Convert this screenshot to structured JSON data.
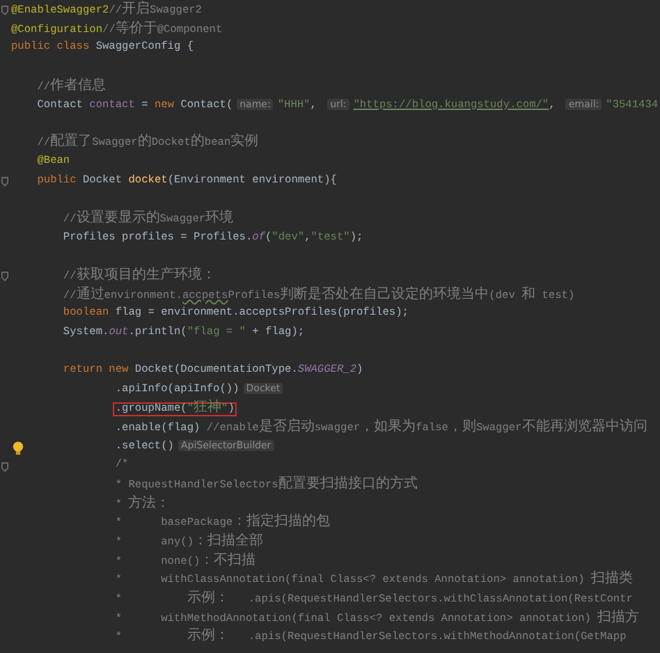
{
  "editor": {
    "lines": [
      {
        "kind": "code",
        "gutter": {
          "kind": "fold"
        },
        "tokens": [
          {
            "kind": "annotation",
            "text": "@EnableSwagger2"
          },
          {
            "kind": "comment",
            "text": "//开启Swagger2"
          }
        ]
      },
      {
        "kind": "code",
        "tokens": [
          {
            "kind": "annotation",
            "text": "@Configuration"
          },
          {
            "kind": "comment",
            "text": "//等价于@Component"
          }
        ]
      },
      {
        "kind": "code",
        "tokens": [
          {
            "kind": "keyword",
            "text": "public class "
          },
          {
            "kind": "plain",
            "text": "SwaggerConfig {"
          }
        ]
      },
      {
        "kind": "blank"
      },
      {
        "kind": "code",
        "tokens": [
          {
            "kind": "comment",
            "text": "    //作者信息"
          }
        ]
      },
      {
        "kind": "code",
        "tokens": [
          {
            "kind": "plain",
            "text": "    Contact "
          },
          {
            "kind": "field",
            "text": "contact"
          },
          {
            "kind": "plain",
            "text": " = "
          },
          {
            "kind": "keyword",
            "text": "new "
          },
          {
            "kind": "plain",
            "text": "Contact("
          },
          {
            "kind": "hint",
            "text": "name:"
          },
          {
            "kind": "string",
            "text": "\"HHH\""
          },
          {
            "kind": "plain",
            "text": ", "
          },
          {
            "kind": "hint",
            "text": "url:"
          },
          {
            "kind": "url",
            "text": "\"https://blog.kuangstudy.com/\""
          },
          {
            "kind": "plain",
            "text": ", "
          },
          {
            "kind": "hint",
            "text": "email:"
          },
          {
            "kind": "string",
            "text": "\"3541434"
          }
        ]
      },
      {
        "kind": "blank"
      },
      {
        "kind": "code",
        "tokens": [
          {
            "kind": "comment",
            "text": "    //配置了Swagger的Docket的bean实例"
          }
        ]
      },
      {
        "kind": "code",
        "tokens": [
          {
            "kind": "annotation",
            "text": "    @Bean"
          }
        ]
      },
      {
        "kind": "code",
        "gutter": {
          "kind": "fold"
        },
        "tokens": [
          {
            "kind": "keyword",
            "text": "    public "
          },
          {
            "kind": "plain",
            "text": "Docket "
          },
          {
            "kind": "method",
            "text": "docket"
          },
          {
            "kind": "plain",
            "text": "(Environment environment){"
          }
        ]
      },
      {
        "kind": "blank"
      },
      {
        "kind": "code",
        "tokens": [
          {
            "kind": "comment",
            "text": "        //设置要显示的Swagger环境"
          }
        ]
      },
      {
        "kind": "code",
        "tokens": [
          {
            "kind": "plain",
            "text": "        Profiles profiles = Profiles."
          },
          {
            "kind": "static",
            "text": "of"
          },
          {
            "kind": "plain",
            "text": "("
          },
          {
            "kind": "string",
            "text": "\"dev\""
          },
          {
            "kind": "plain",
            "text": ","
          },
          {
            "kind": "string",
            "text": "\"test\""
          },
          {
            "kind": "plain",
            "text": ");"
          }
        ]
      },
      {
        "kind": "blank"
      },
      {
        "kind": "code",
        "gutter": {
          "kind": "fold"
        },
        "tokens": [
          {
            "kind": "comment",
            "text": "        //获取项目的生产环境："
          }
        ]
      },
      {
        "kind": "code",
        "tokens": [
          {
            "kind": "comment",
            "text": "        //通过environment."
          },
          {
            "kind": "typo",
            "text": "accpets"
          },
          {
            "kind": "comment",
            "text": "Profiles判断是否处在自己设定的环境当中(dev 和 test)"
          }
        ]
      },
      {
        "kind": "code",
        "tokens": [
          {
            "kind": "keyword",
            "text": "        boolean "
          },
          {
            "kind": "plain",
            "text": "flag = environment.acceptsProfiles(profiles);"
          }
        ]
      },
      {
        "kind": "code",
        "tokens": [
          {
            "kind": "plain",
            "text": "        System."
          },
          {
            "kind": "static",
            "text": "out"
          },
          {
            "kind": "plain",
            "text": ".println("
          },
          {
            "kind": "string",
            "text": "\"flag = \""
          },
          {
            "kind": "plain",
            "text": " + flag);"
          }
        ]
      },
      {
        "kind": "blank"
      },
      {
        "kind": "code",
        "tokens": [
          {
            "kind": "keyword",
            "text": "        return new "
          },
          {
            "kind": "plain",
            "text": "Docket(DocumentationType."
          },
          {
            "kind": "static",
            "text": "SWAGGER_2"
          },
          {
            "kind": "plain",
            "text": ")"
          }
        ]
      },
      {
        "kind": "code",
        "tokens": [
          {
            "kind": "plain",
            "text": "                .apiInfo(apiInfo())"
          },
          {
            "kind": "hint",
            "text": "Docket"
          }
        ]
      },
      {
        "kind": "code",
        "highlight": true,
        "tokens": [
          {
            "kind": "plain",
            "text": "                .groupName("
          },
          {
            "kind": "string",
            "text": "\"狂神\""
          },
          {
            "kind": "plain",
            "text": ")"
          }
        ]
      },
      {
        "kind": "code",
        "tokens": [
          {
            "kind": "plain",
            "text": "                .enable(flag) "
          },
          {
            "kind": "comment",
            "text": "//enable是否启动swagger，如果为false，则Swagger不能再浏览器中访问"
          }
        ]
      },
      {
        "kind": "code",
        "gutter": {
          "kind": "bulb"
        },
        "tokens": [
          {
            "kind": "plain",
            "text": "                .select()"
          },
          {
            "kind": "hint",
            "text": "ApiSelectorBuilder"
          }
        ]
      },
      {
        "kind": "code",
        "gutter": {
          "kind": "fold"
        },
        "tokens": [
          {
            "kind": "comment",
            "text": "                /*"
          }
        ]
      },
      {
        "kind": "code",
        "tokens": [
          {
            "kind": "comment",
            "text": "                * RequestHandlerSelectors配置要扫描接口的方式"
          }
        ]
      },
      {
        "kind": "code",
        "tokens": [
          {
            "kind": "comment",
            "text": "                * 方法："
          }
        ]
      },
      {
        "kind": "code",
        "tokens": [
          {
            "kind": "comment",
            "text": "                *      basePackage：指定扫描的包"
          }
        ]
      },
      {
        "kind": "code",
        "tokens": [
          {
            "kind": "comment",
            "text": "                *      any()：扫描全部"
          }
        ]
      },
      {
        "kind": "code",
        "tokens": [
          {
            "kind": "comment",
            "text": "                *      none()：不扫描"
          }
        ]
      },
      {
        "kind": "code",
        "tokens": [
          {
            "kind": "comment",
            "text": "                *      withClassAnnotation(final Class<? extends Annotation> annotation) 扫描类"
          }
        ]
      },
      {
        "kind": "code",
        "tokens": [
          {
            "kind": "comment",
            "text": "                *          示例：   .apis(RequestHandlerSelectors.withClassAnnotation(RestContr"
          }
        ]
      },
      {
        "kind": "code",
        "tokens": [
          {
            "kind": "comment",
            "text": "                *      withMethodAnnotation(final Class<? extends Annotation> annotation) 扫描方"
          }
        ]
      },
      {
        "kind": "code",
        "tokens": [
          {
            "kind": "comment",
            "text": "                *          示例：   .apis(RequestHandlerSelectors.withMethodAnnotation(GetMapp"
          }
        ]
      }
    ]
  }
}
